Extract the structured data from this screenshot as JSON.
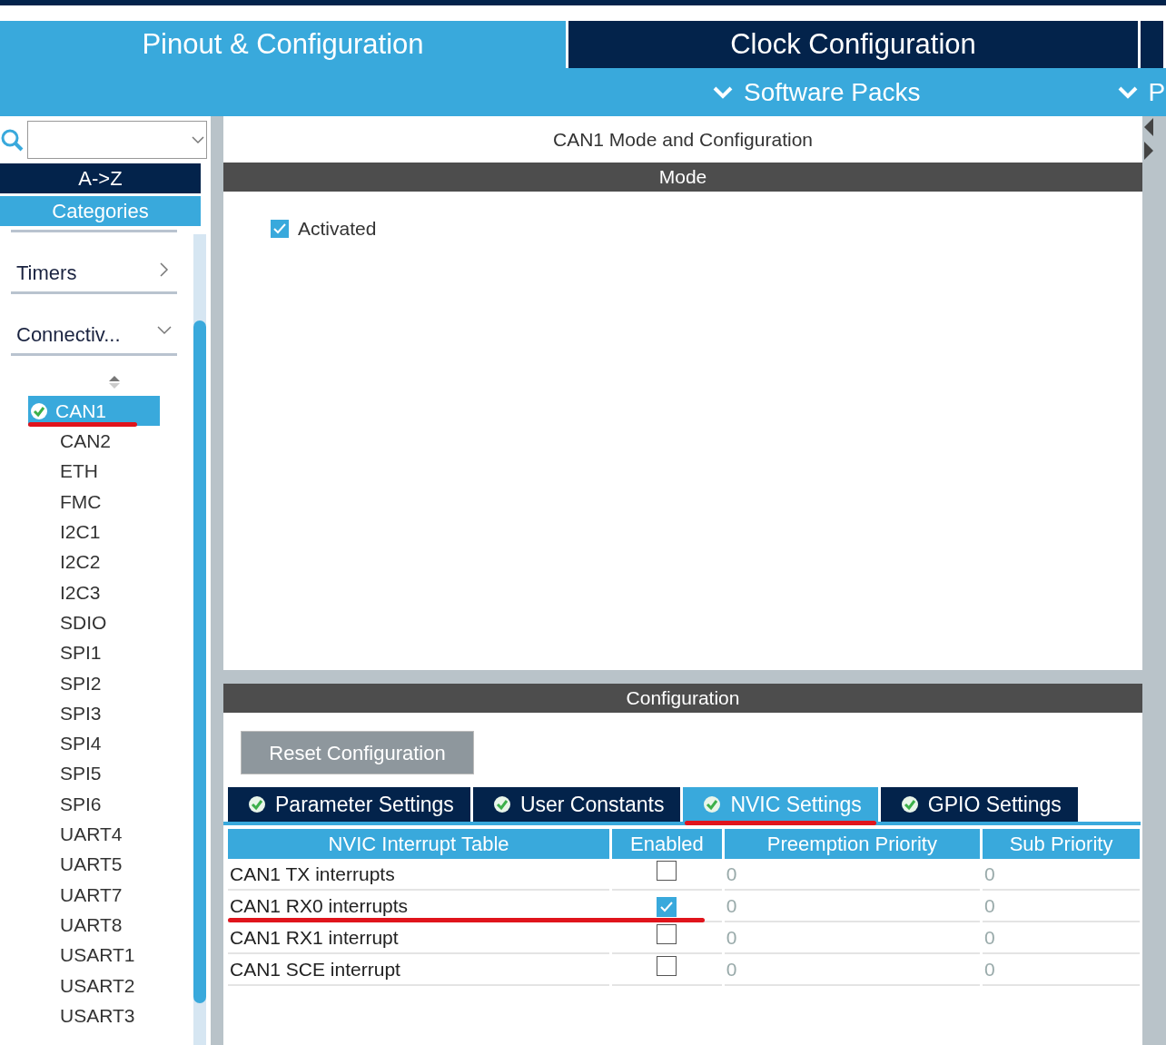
{
  "main_tabs": [
    {
      "label": "Pinout & Configuration",
      "selected": true
    },
    {
      "label": "Clock Configuration",
      "selected": false
    },
    {
      "selected": false
    }
  ],
  "sub_menus": [
    {
      "label": "Software Packs"
    },
    {
      "label": "P"
    }
  ],
  "sidebar": {
    "sort_buttons": [
      {
        "label": "A->Z",
        "selected": false
      },
      {
        "label": "Categories",
        "selected": true
      }
    ],
    "groups": [
      {
        "label": "Timers",
        "expanded": false
      },
      {
        "label": "Connectiv...",
        "expanded": true
      }
    ],
    "items": [
      {
        "label": "CAN1",
        "selected": true,
        "configured": true,
        "underlined": true
      },
      {
        "label": "CAN2",
        "selected": false,
        "configured": false,
        "underlined": false
      },
      {
        "label": "ETH",
        "selected": false,
        "configured": false,
        "underlined": false
      },
      {
        "label": "FMC",
        "selected": false,
        "configured": false,
        "underlined": false
      },
      {
        "label": "I2C1",
        "selected": false,
        "configured": false,
        "underlined": false
      },
      {
        "label": "I2C2",
        "selected": false,
        "configured": false,
        "underlined": false
      },
      {
        "label": "I2C3",
        "selected": false,
        "configured": false,
        "underlined": false
      },
      {
        "label": "SDIO",
        "selected": false,
        "configured": false,
        "underlined": false
      },
      {
        "label": "SPI1",
        "selected": false,
        "configured": false,
        "underlined": false
      },
      {
        "label": "SPI2",
        "selected": false,
        "configured": false,
        "underlined": false
      },
      {
        "label": "SPI3",
        "selected": false,
        "configured": false,
        "underlined": false
      },
      {
        "label": "SPI4",
        "selected": false,
        "configured": false,
        "underlined": false
      },
      {
        "label": "SPI5",
        "selected": false,
        "configured": false,
        "underlined": false
      },
      {
        "label": "SPI6",
        "selected": false,
        "configured": false,
        "underlined": false
      },
      {
        "label": "UART4",
        "selected": false,
        "configured": false,
        "underlined": false
      },
      {
        "label": "UART5",
        "selected": false,
        "configured": false,
        "underlined": false
      },
      {
        "label": "UART7",
        "selected": false,
        "configured": false,
        "underlined": false
      },
      {
        "label": "UART8",
        "selected": false,
        "configured": false,
        "underlined": false
      },
      {
        "label": "USART1",
        "selected": false,
        "configured": false,
        "underlined": false
      },
      {
        "label": "USART2",
        "selected": false,
        "configured": false,
        "underlined": false
      },
      {
        "label": "USART3",
        "selected": false,
        "configured": false,
        "underlined": false
      }
    ]
  },
  "panel": {
    "title": "CAN1 Mode and Configuration",
    "mode": {
      "header": "Mode",
      "activated": {
        "label": "Activated",
        "checked": true
      }
    },
    "configuration": {
      "header": "Configuration",
      "reset_button": "Reset Configuration",
      "tabs": [
        {
          "label": "Parameter Settings",
          "selected": false,
          "underlined": false
        },
        {
          "label": "User Constants",
          "selected": false,
          "underlined": false
        },
        {
          "label": "NVIC Settings",
          "selected": true,
          "underlined": true
        },
        {
          "label": "GPIO Settings",
          "selected": false,
          "underlined": false
        }
      ],
      "table": {
        "columns": [
          "NVIC Interrupt Table",
          "Enabled",
          "Preemption Priority",
          "Sub Priority"
        ],
        "rows": [
          {
            "name": "CAN1 TX interrupts",
            "enabled": false,
            "preemption": "0",
            "sub": "0",
            "underlined": false
          },
          {
            "name": "CAN1 RX0 interrupts",
            "enabled": true,
            "preemption": "0",
            "sub": "0",
            "underlined": true
          },
          {
            "name": "CAN1 RX1 interrupt",
            "enabled": false,
            "preemption": "0",
            "sub": "0",
            "underlined": false
          },
          {
            "name": "CAN1 SCE interrupt",
            "enabled": false,
            "preemption": "0",
            "sub": "0",
            "underlined": false
          }
        ]
      }
    }
  }
}
